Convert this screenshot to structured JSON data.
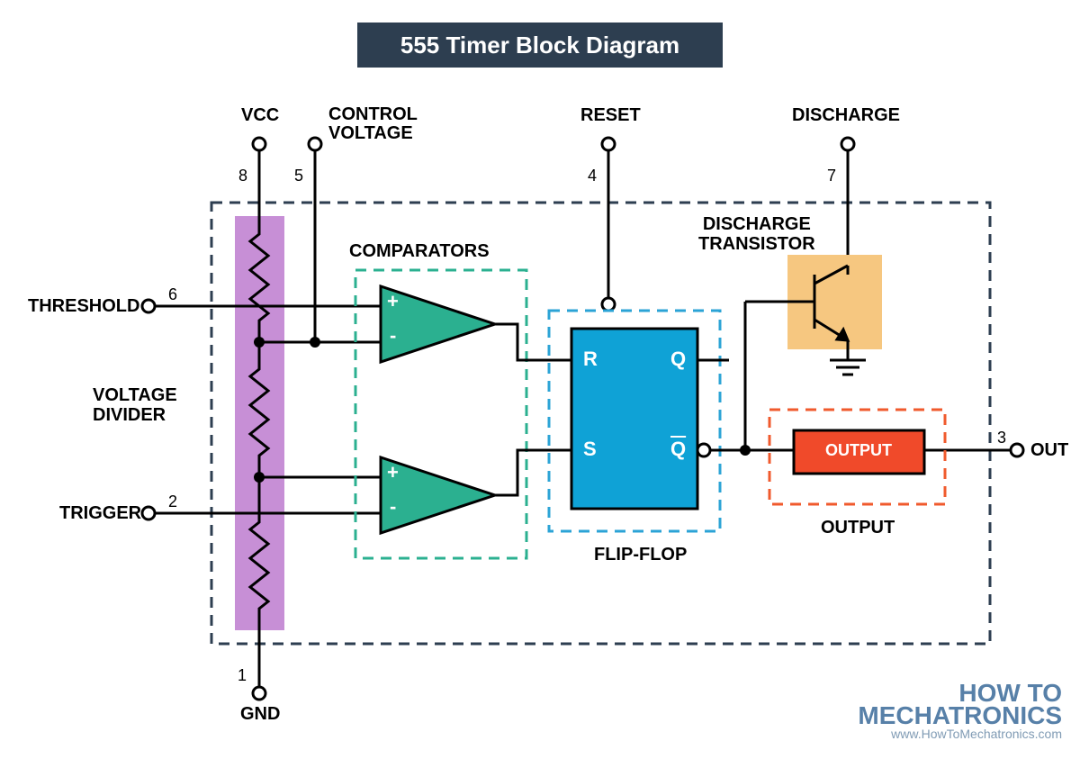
{
  "title": "555 Timer Block Diagram",
  "pins": {
    "vcc": {
      "num": "8",
      "label": "VCC"
    },
    "control": {
      "num": "5",
      "label": "CONTROL\nVOLTAGE"
    },
    "reset": {
      "num": "4",
      "label": "RESET"
    },
    "discharge": {
      "num": "7",
      "label": "DISCHARGE"
    },
    "threshold": {
      "num": "6",
      "label": "THRESHOLD"
    },
    "trigger": {
      "num": "2",
      "label": "TRIGGER"
    },
    "out": {
      "num": "3",
      "label": "OUT"
    },
    "gnd": {
      "num": "1",
      "label": "GND"
    }
  },
  "blocks": {
    "divider": "VOLTAGE\nDIVIDER",
    "comparators": "COMPARATORS",
    "flipflop": "FLIP-FLOP",
    "discharge_tr": "DISCHARGE\nTRANSISTOR",
    "output_stage": "OUTPUT",
    "output_block": "OUTPUT"
  },
  "flipflop_labels": {
    "r": "R",
    "s": "S",
    "q": "Q",
    "qbar": "Q"
  },
  "comparator_signs": {
    "plus": "+",
    "minus": "-"
  },
  "watermark": {
    "line1": "HOW TO",
    "line2": "MECHATRONICS",
    "url": "www.HowToMechatronics.com"
  }
}
